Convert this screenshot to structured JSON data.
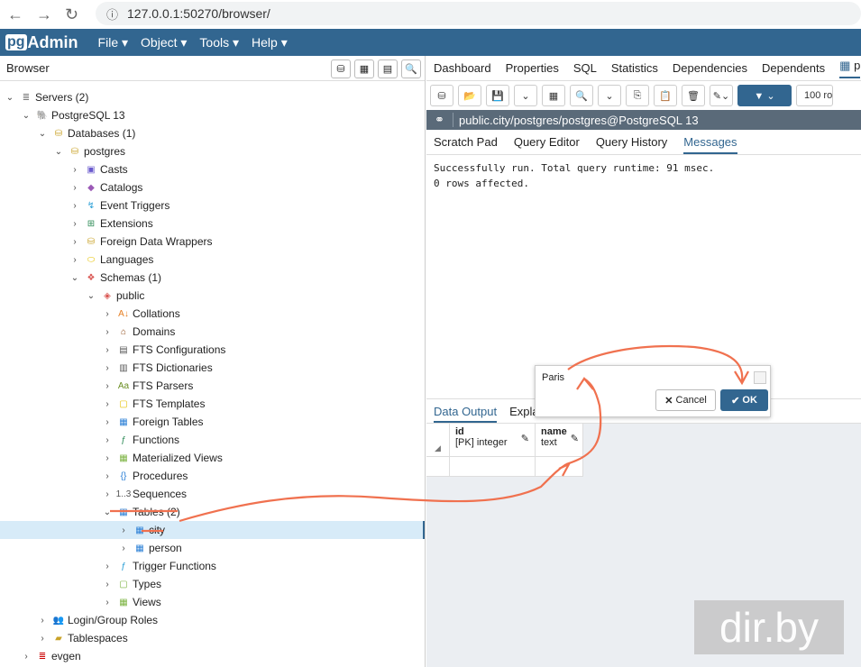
{
  "browser": {
    "url": "127.0.0.1:50270/browser/"
  },
  "app": {
    "logo_pg": "pg",
    "logo_rest": "Admin",
    "menu": [
      "File",
      "Object",
      "Tools",
      "Help"
    ]
  },
  "left": {
    "title": "Browser"
  },
  "tree": [
    {
      "label": "Servers (2)",
      "level": 0,
      "chev": "v",
      "icon": "servers-icon",
      "glyph": "≣",
      "color": "#777"
    },
    {
      "label": "PostgreSQL 13",
      "level": 1,
      "chev": "v",
      "icon": "elephant-icon",
      "glyph": "🐘",
      "color": "#336791"
    },
    {
      "label": "Databases (1)",
      "level": 2,
      "chev": "v",
      "icon": "databases-icon",
      "glyph": "⛁",
      "color": "#c9a227"
    },
    {
      "label": "postgres",
      "level": 3,
      "chev": "v",
      "icon": "database-icon",
      "glyph": "⛁",
      "color": "#c9a227"
    },
    {
      "label": "Casts",
      "level": 4,
      "chev": ">",
      "icon": "casts-icon",
      "glyph": "▣",
      "color": "#6a5acd"
    },
    {
      "label": "Catalogs",
      "level": 4,
      "chev": ">",
      "icon": "catalogs-icon",
      "glyph": "◆",
      "color": "#9b59b6"
    },
    {
      "label": "Event Triggers",
      "level": 4,
      "chev": ">",
      "icon": "event-triggers-icon",
      "glyph": "↯",
      "color": "#2a9fd6"
    },
    {
      "label": "Extensions",
      "level": 4,
      "chev": ">",
      "icon": "extensions-icon",
      "glyph": "⊞",
      "color": "#2e8b57"
    },
    {
      "label": "Foreign Data Wrappers",
      "level": 4,
      "chev": ">",
      "icon": "fdw-icon",
      "glyph": "⛁",
      "color": "#c9a227"
    },
    {
      "label": "Languages",
      "level": 4,
      "chev": ">",
      "icon": "languages-icon",
      "glyph": "⬭",
      "color": "#e6c200"
    },
    {
      "label": "Schemas (1)",
      "level": 4,
      "chev": "v",
      "icon": "schemas-icon",
      "glyph": "❖",
      "color": "#d9534f"
    },
    {
      "label": "public",
      "level": 5,
      "chev": "v",
      "icon": "schema-icon",
      "glyph": "◈",
      "color": "#d9534f"
    },
    {
      "label": "Collations",
      "level": 6,
      "chev": ">",
      "icon": "collations-icon",
      "glyph": "A↓",
      "color": "#e67e22"
    },
    {
      "label": "Domains",
      "level": 6,
      "chev": ">",
      "icon": "domains-icon",
      "glyph": "⌂",
      "color": "#8b4513"
    },
    {
      "label": "FTS Configurations",
      "level": 6,
      "chev": ">",
      "icon": "fts-configurations-icon",
      "glyph": "▤",
      "color": "#555"
    },
    {
      "label": "FTS Dictionaries",
      "level": 6,
      "chev": ">",
      "icon": "fts-dictionaries-icon",
      "glyph": "▥",
      "color": "#555"
    },
    {
      "label": "FTS Parsers",
      "level": 6,
      "chev": ">",
      "icon": "fts-parsers-icon",
      "glyph": "Aa",
      "color": "#6b8e23"
    },
    {
      "label": "FTS Templates",
      "level": 6,
      "chev": ">",
      "icon": "fts-templates-icon",
      "glyph": "▢",
      "color": "#e6c200"
    },
    {
      "label": "Foreign Tables",
      "level": 6,
      "chev": ">",
      "icon": "foreign-tables-icon",
      "glyph": "▦",
      "color": "#2a7fd6"
    },
    {
      "label": "Functions",
      "level": 6,
      "chev": ">",
      "icon": "functions-icon",
      "glyph": "ƒ",
      "color": "#2e8b57"
    },
    {
      "label": "Materialized Views",
      "level": 6,
      "chev": ">",
      "icon": "materialized-views-icon",
      "glyph": "▦",
      "color": "#7cb342"
    },
    {
      "label": "Procedures",
      "level": 6,
      "chev": ">",
      "icon": "procedures-icon",
      "glyph": "{}",
      "color": "#2a7fd6"
    },
    {
      "label": "Sequences",
      "level": 6,
      "chev": ">",
      "icon": "sequences-icon",
      "glyph": "1..3",
      "color": "#555"
    },
    {
      "label": "Tables (2)",
      "level": 6,
      "chev": "v",
      "icon": "tables-icon",
      "glyph": "▦",
      "color": "#2a7fd6"
    },
    {
      "label": "city",
      "level": 7,
      "chev": ">",
      "icon": "table-icon",
      "glyph": "▦",
      "color": "#2a7fd6",
      "selected": true
    },
    {
      "label": "person",
      "level": 7,
      "chev": ">",
      "icon": "table-icon",
      "glyph": "▦",
      "color": "#2a7fd6"
    },
    {
      "label": "Trigger Functions",
      "level": 6,
      "chev": ">",
      "icon": "trigger-functions-icon",
      "glyph": "ƒ",
      "color": "#2a9fd6"
    },
    {
      "label": "Types",
      "level": 6,
      "chev": ">",
      "icon": "types-icon",
      "glyph": "▢",
      "color": "#7cb342"
    },
    {
      "label": "Views",
      "level": 6,
      "chev": ">",
      "icon": "views-icon",
      "glyph": "▦",
      "color": "#7cb342"
    },
    {
      "label": "Login/Group Roles",
      "level": 2,
      "chev": ">",
      "icon": "roles-icon",
      "glyph": "👥",
      "color": "#336791"
    },
    {
      "label": "Tablespaces",
      "level": 2,
      "chev": ">",
      "icon": "tablespaces-icon",
      "glyph": "▰",
      "color": "#c9a227"
    },
    {
      "label": "evgen",
      "level": 1,
      "chev": ">",
      "icon": "server-disconnected-icon",
      "glyph": "≣",
      "color": "#c00"
    }
  ],
  "right": {
    "tabs": [
      "Dashboard",
      "Properties",
      "SQL",
      "Statistics",
      "Dependencies",
      "Dependents",
      "p"
    ],
    "row_limit": "100 ro",
    "connection": "public.city/postgres/postgres@PostgreSQL 13",
    "subtabs": [
      "Scratch Pad",
      "Query Editor",
      "Query History",
      "Messages"
    ],
    "messages": [
      "Successfully run. Total query runtime: 91 msec.",
      "0 rows affected."
    ],
    "output_tabs": [
      "Data Output",
      "Expla"
    ],
    "columns": [
      {
        "name": "id",
        "type": "[PK] integer"
      },
      {
        "name": "name",
        "type": "text"
      }
    ]
  },
  "popup": {
    "value": "Paris",
    "cancel": "Cancel",
    "ok": "OK"
  },
  "watermark": "dir.by"
}
